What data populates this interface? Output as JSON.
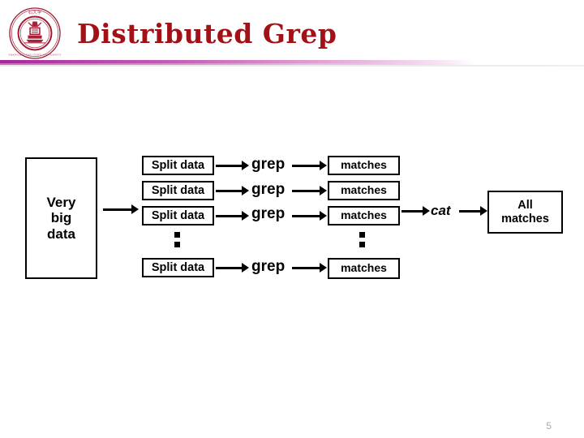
{
  "slide": {
    "title": "Distributed Grep",
    "page_number": "5",
    "title_color": "#A11116",
    "rule_color": "#a8259c",
    "logo": {
      "icon": "university-seal-icon",
      "ring_color": "#9E1B32",
      "inner_color": "#B3283C"
    }
  },
  "diagram": {
    "source": {
      "label": "Very\nbig\ndata",
      "line1": "Very",
      "line2": "big",
      "line3": "data"
    },
    "split_label": "Split data",
    "map_label": "grep",
    "match_label": "matches",
    "reduce_label": "cat",
    "result": {
      "line1": "All",
      "line2": "matches"
    },
    "rows": [
      {
        "split": "Split data",
        "op": "grep",
        "match": "matches"
      },
      {
        "split": "Split data",
        "op": "grep",
        "match": "matches"
      },
      {
        "split": "Split data",
        "op": "grep",
        "match": "matches"
      },
      {
        "split": "Split data",
        "op": "grep",
        "match": "matches"
      }
    ],
    "ellipsis": "••"
  }
}
